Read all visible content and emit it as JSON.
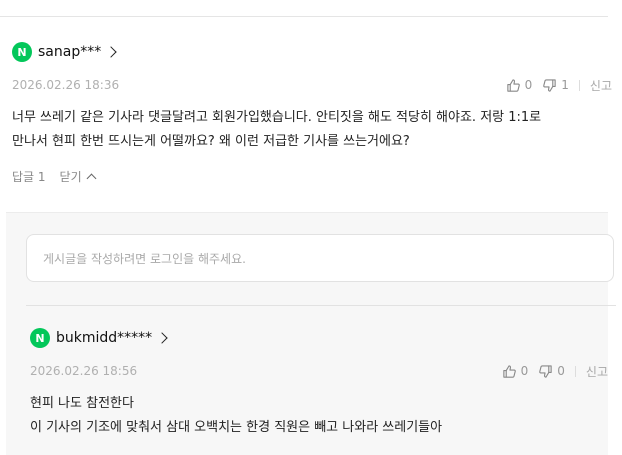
{
  "main_comment": {
    "author": "sanap***",
    "timestamp": "2026.02.26 18:36",
    "likes": "0",
    "dislikes": "1",
    "report_label": "신고",
    "body": "너무 쓰레기 같은 기사라 댓글달려고 회원가입했습니다. 안티짓을 해도 적당히 해야죠. 저랑 1:1로\n만나서 현피 한번 뜨시는게 어떨까요? 왜 이런 저급한 기사를 쓰는거에요?",
    "reply_label": "답글 1",
    "close_label": "닫기"
  },
  "reply_input": {
    "placeholder": "게시글을 작성하려면 로그인을 해주세요."
  },
  "reply_comment": {
    "author": "bukmidd*****",
    "timestamp": "2026.02.26 18:56",
    "likes": "0",
    "dislikes": "0",
    "report_label": "신고",
    "body": "현피 나도 참전한다\n이 기사의 기조에 맞춰서 삼대 오백치는 한경 직원은 빼고 나와라 쓰레기들아"
  },
  "badge_letter": "N",
  "colors": {
    "naver_green": "#03c75a",
    "panel_bg": "#f7f7f7"
  },
  "icons": [
    "chevron-right-icon",
    "thumbs-up-icon",
    "thumbs-down-icon",
    "chevron-up-icon"
  ]
}
